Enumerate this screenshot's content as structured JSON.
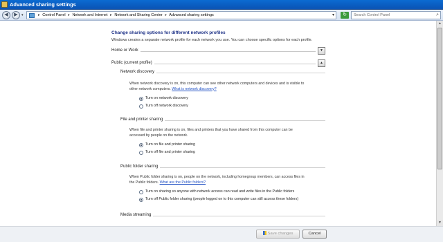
{
  "window": {
    "title": "Advanced sharing settings"
  },
  "address_bar": {
    "crumbs": [
      "Control Panel",
      "Network and Internet",
      "Network and Sharing Center",
      "Advanced sharing settings"
    ],
    "search_placeholder": "Search Control Panel"
  },
  "main": {
    "heading": "Change sharing options for different network profiles",
    "intro": "Windows creates a separate network profile for each network you use. You can choose specific options for each profile.",
    "profiles": [
      {
        "label": "Home or Work",
        "expanded": false
      },
      {
        "label": "Public (current profile)",
        "expanded": true
      }
    ],
    "sections": {
      "discovery": {
        "title": "Network discovery",
        "desc_line1": "When network discovery is on, this computer can see other network computers and devices and is visible to",
        "desc_line2": "other network computers.",
        "link": "What is network discovery?",
        "options": [
          "Turn on network discovery",
          "Turn off network discovery"
        ],
        "selected": 0
      },
      "file_printer": {
        "title": "File and printer sharing",
        "desc_line1": "When file and printer sharing is on, files and printers that you have shared from this computer can be",
        "desc_line2": "accessed by people on the network.",
        "options": [
          "Turn on file and printer sharing",
          "Turn off file and printer sharing"
        ],
        "selected": 0
      },
      "public_folder": {
        "title": "Public folder sharing",
        "desc_line1": "When Public folder sharing is on, people on the network, including homegroup members, can access files in",
        "desc_line2": "the Public folders.",
        "link": "What are the Public folders?",
        "options": [
          "Turn on sharing so anyone with network access can read and write files in the Public folders",
          "Turn off Public folder sharing (people logged on to this computer can still access these folders)"
        ],
        "selected": 1
      },
      "media": {
        "title": "Media streaming"
      }
    }
  },
  "buttons": {
    "save": "Save changes",
    "cancel": "Cancel"
  }
}
